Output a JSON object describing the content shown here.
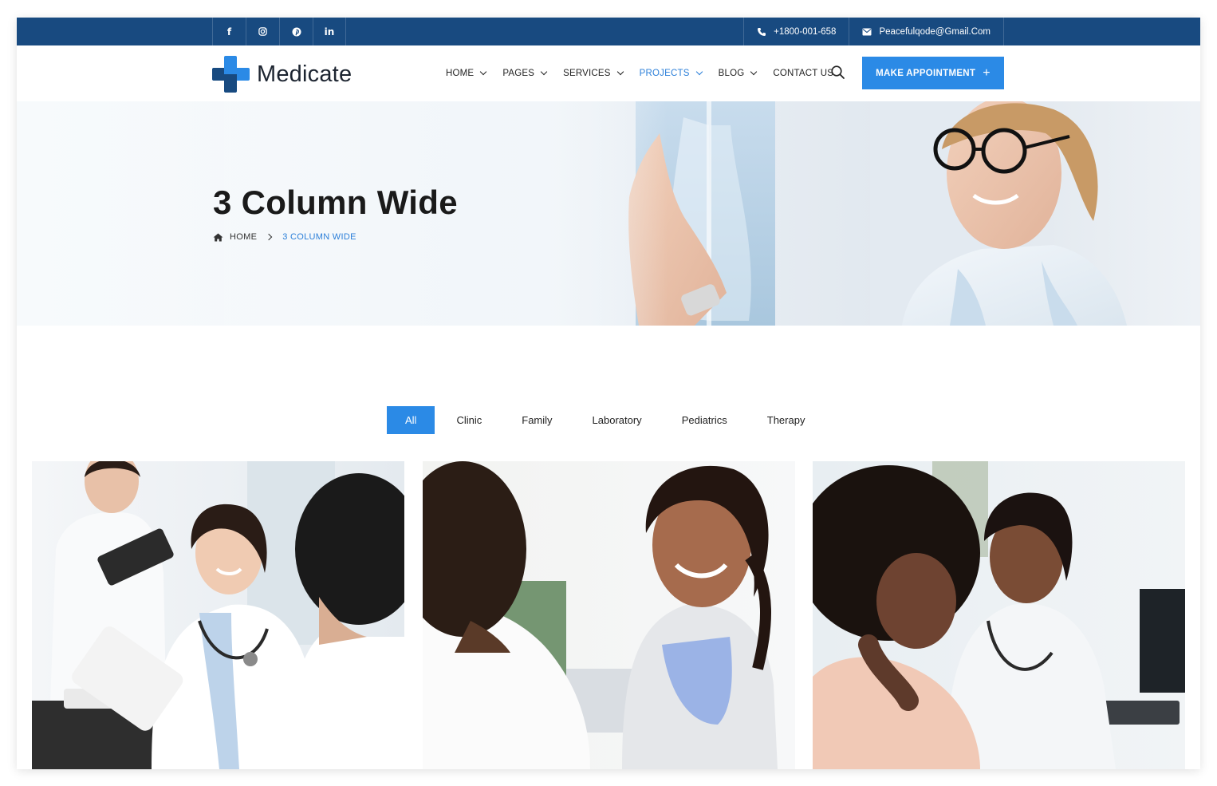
{
  "topbar": {
    "social": [
      {
        "icon": "facebook-icon",
        "glyph": "f"
      },
      {
        "icon": "instagram-icon",
        "glyph": "◎"
      },
      {
        "icon": "pinterest-icon",
        "glyph": "℗"
      },
      {
        "icon": "linkedin-icon",
        "glyph": "in"
      }
    ],
    "phone": "+1800-001-658",
    "email": "Peacefulqode@Gmail.Com"
  },
  "header": {
    "logo_text": "Medicate",
    "nav": [
      {
        "label": "HOME",
        "dropdown": true,
        "active": false
      },
      {
        "label": "PAGES",
        "dropdown": true,
        "active": false
      },
      {
        "label": "SERVICES",
        "dropdown": true,
        "active": false
      },
      {
        "label": "PROJECTS",
        "dropdown": true,
        "active": true
      },
      {
        "label": "BLOG",
        "dropdown": true,
        "active": false
      },
      {
        "label": "CONTACT US",
        "dropdown": false,
        "active": false
      }
    ],
    "cta_label": "MAKE APPOINTMENT",
    "cta_icon": "+"
  },
  "hero": {
    "title": "3 Column Wide",
    "breadcrumb": {
      "home": "HOME",
      "current": "3 COLUMN WIDE"
    }
  },
  "filters": {
    "items": [
      "All",
      "Clinic",
      "Family",
      "Laboratory",
      "Pediatrics",
      "Therapy"
    ],
    "active": "All"
  },
  "colors": {
    "topbar": "#184a80",
    "accent": "#2b8ae6",
    "active_link": "#2b7fd9",
    "text_dark": "#1a1a1a"
  }
}
